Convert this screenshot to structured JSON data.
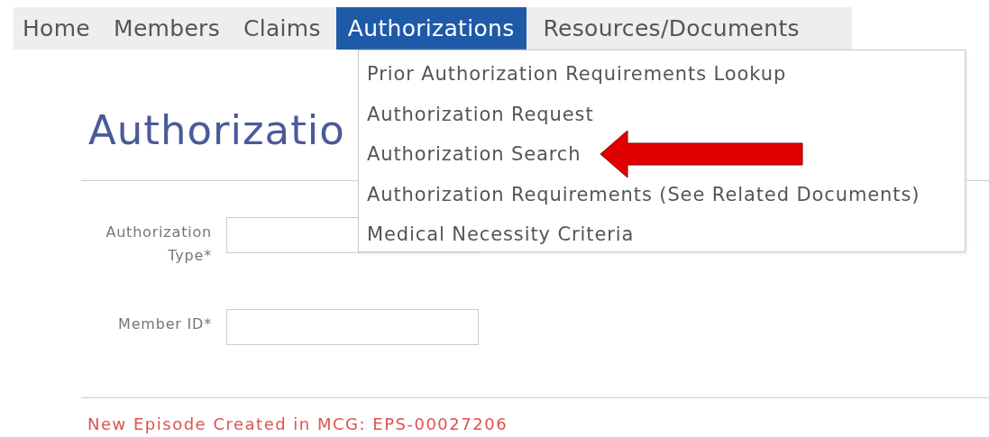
{
  "nav": [
    {
      "label": "Home",
      "selected": false
    },
    {
      "label": "Members",
      "selected": false
    },
    {
      "label": "Claims",
      "selected": false
    },
    {
      "label": "Authorizations",
      "selected": true
    },
    {
      "label": "Resources/Documents",
      "selected": false
    }
  ],
  "dropdown": [
    {
      "label": "Prior Authorization Requirements Lookup",
      "pointed": false
    },
    {
      "label": "Authorization Request",
      "pointed": false
    },
    {
      "label": "Authorization Search",
      "pointed": true
    },
    {
      "label": "Authorization Requirements (See Related Documents)",
      "pointed": false
    },
    {
      "label": "Medical Necessity Criteria",
      "pointed": false
    }
  ],
  "page_title": "Authorizatio",
  "fields": [
    {
      "label": "Authorization Type*"
    },
    {
      "label": "Member ID*"
    }
  ],
  "message": "New Episode Created in MCG: EPS-00027206"
}
